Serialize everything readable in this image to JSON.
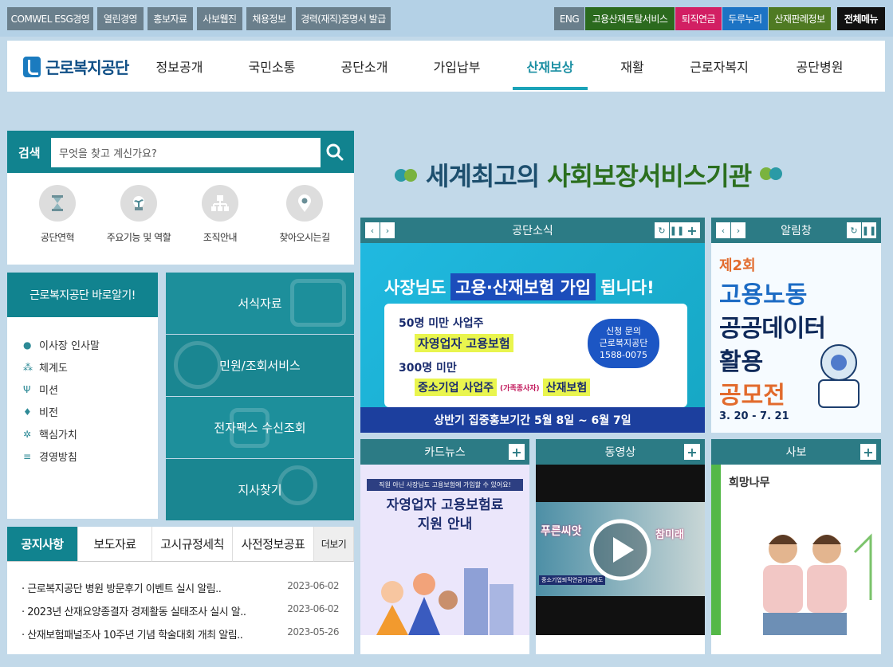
{
  "util_left": [
    "COMWEL ESG경영",
    "열린경영",
    "홍보자료",
    "사보웹진",
    "채용정보",
    "경력(재직)증명서 발급"
  ],
  "util_right": [
    {
      "label": "ENG",
      "color": "#6a7f8c"
    },
    {
      "label": "고용산재토탈서비스",
      "color": "#2b6a1e"
    },
    {
      "label": "퇴직연금",
      "color": "#d21f63"
    },
    {
      "label": "두루누리",
      "color": "#1c73c4"
    },
    {
      "label": "산재판례정보",
      "color": "#4f7a23"
    },
    {
      "label": "전체메뉴",
      "color": "#111111"
    }
  ],
  "logo": "근로복지공단",
  "nav": [
    "정보공개",
    "국민소통",
    "공단소개",
    "가입납부",
    "산재보상",
    "재활",
    "근로자복지",
    "공단병원"
  ],
  "active_nav": "산재보상",
  "search": {
    "title": "검색",
    "placeholder": "무엇을 찾고 계신가요?"
  },
  "quick": [
    {
      "label": "공단연혁",
      "icon": "hourglass-icon"
    },
    {
      "label": "주요기능 및 역할",
      "icon": "plant-icon"
    },
    {
      "label": "조직안내",
      "icon": "org-chart-icon"
    },
    {
      "label": "찾아오시는길",
      "icon": "location-pin-icon"
    }
  ],
  "know": {
    "title": "근로복지공단 바로알기!",
    "items": [
      "이사장 인사말",
      "체계도",
      "미션",
      "비전",
      "핵심가치",
      "경영방침"
    ]
  },
  "tiles": [
    "서식자료",
    "민원/조회서비스",
    "전자팩스 수신조회",
    "지사찾기"
  ],
  "notice": {
    "tabs": [
      "공지사항",
      "보도자료",
      "고시규정세칙",
      "사전정보공표"
    ],
    "more": "더보기",
    "items": [
      {
        "title": "근로복지공단 병원 방문후기 이벤트 실시 알림..",
        "date": "2023-06-02"
      },
      {
        "title": "2023년 산재요양종결자 경제활동 실태조사 실시 알..",
        "date": "2023-06-02"
      },
      {
        "title": "산재보험패널조사 10주년 기념 학술대회 개최 알림..",
        "date": "2023-05-26"
      }
    ]
  },
  "slogan": {
    "part1": "세계최고의",
    "part2": "사회보장서비스기관"
  },
  "panels": {
    "news": "공단소식",
    "alarm": "알림창",
    "card": "카드뉴스",
    "video": "동영상",
    "webzine": "사보"
  },
  "banner_news": {
    "headline1": "사장님도",
    "headline2": "고용·산재보험 가입",
    "headline3": "됩니다!",
    "line1": "50명 미만 사업주",
    "line1b": "자영업자 고용보험",
    "line2": "300명 미만",
    "line2b": "중소기업 사업주",
    "line2c": "(가족종사자)",
    "line2d": "산재보험",
    "badge1": "신청 문의",
    "badge2": "근로복지공단",
    "badge3": "1588-0075",
    "footer": "상반기 집중홍보기간 5월 8일 ~ 6월 7일"
  },
  "banner_alarm": {
    "l1": "제2회",
    "l2": "고용노동",
    "l3": "공공데이터",
    "l4": "활용",
    "l5": "공모전",
    "date": "3. 20 - 7. 21"
  },
  "banner_card": {
    "top": "직원 아닌 사장님도 고용보험에 가입할 수 있어요!",
    "l1": "자영업자 고용보험료",
    "l2": "지원 안내"
  },
  "banner_video": {
    "left": "푸른씨앗",
    "right": "참미래",
    "caption": "중소기업퇴직연금기금제도"
  },
  "banner_webzine": {
    "title": "희망나무"
  }
}
